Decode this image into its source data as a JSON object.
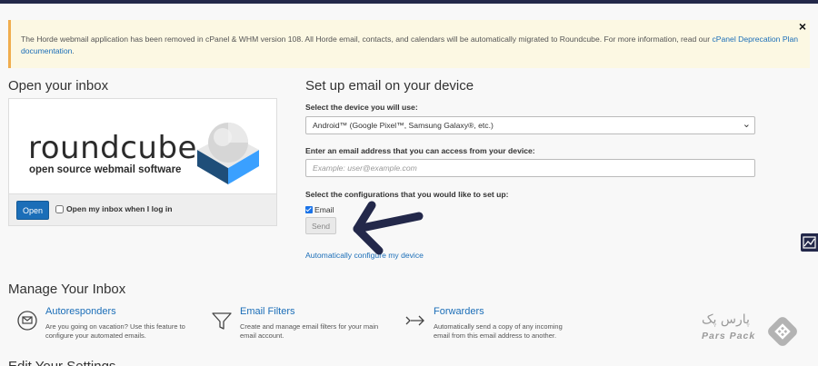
{
  "notice": {
    "text": "The Horde webmail application has been removed in cPanel & WHM version 108. All Horde email, contacts, and calendars will be automatically migrated to Roundcube. For more information, read our ",
    "link": "cPanel Deprecation Plan documentation",
    "tail": ".",
    "close": "×"
  },
  "inbox": {
    "title": "Open your inbox",
    "logo_word": "roundcube",
    "logo_sub": "open source webmail software",
    "open_label": "Open",
    "auto_open_label": "Open my inbox when I log in"
  },
  "setup": {
    "title": "Set up email on your device",
    "device_label": "Select the device you will use:",
    "device_value": "Android™ (Google Pixel™, Samsung Galaxy®, etc.)",
    "email_label": "Enter an email address that you can access from your device:",
    "email_placeholder": "Example: user@example.com",
    "config_label": "Select the configurations that you would like to set up:",
    "email_checkbox_label": "Email",
    "send_label": "Send",
    "auto_config_link": "Automatically configure my device"
  },
  "manage": {
    "title": "Manage Your Inbox",
    "features": [
      {
        "title": "Autoresponders",
        "desc1": "Are you going on vacation? Use this feature to",
        "desc2": "configure your automated emails.",
        "icon": "autoresponder-icon"
      },
      {
        "title": "Email Filters",
        "desc1": "Create and manage email filters for your main",
        "desc2": "email account.",
        "icon": "filter-icon"
      },
      {
        "title": "Forwarders",
        "desc1": "Automatically send a copy of any incoming",
        "desc2": "email from this email address to another.",
        "icon": "forward-icon"
      }
    ]
  },
  "edit": {
    "title": "Edit Your Settings"
  },
  "watermark": {
    "fa": "پارس پک",
    "en": "Pars Pack"
  },
  "colors": {
    "accent": "#1b6eb8",
    "notice_bg": "#fcf8e3",
    "notice_border": "#f0ad4e",
    "topbar": "#23284a"
  }
}
